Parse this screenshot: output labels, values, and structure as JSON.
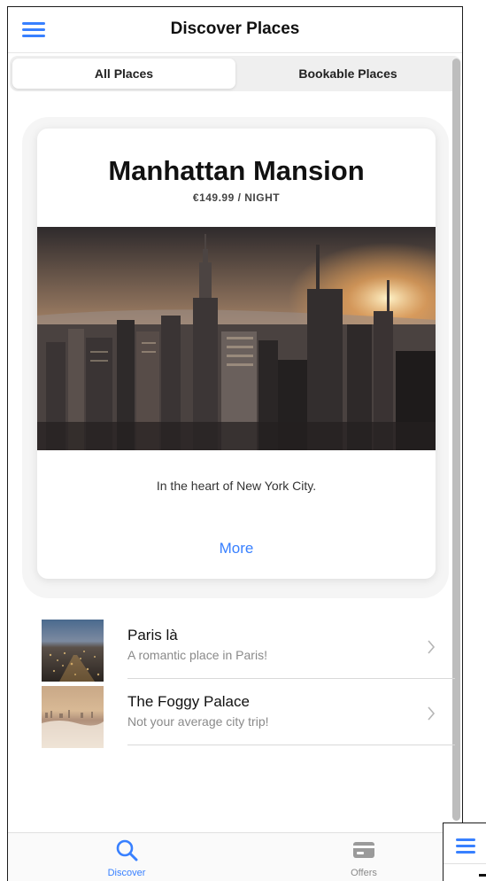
{
  "header": {
    "title": "Discover Places"
  },
  "segments": [
    {
      "label": "All Places",
      "active": true
    },
    {
      "label": "Bookable Places",
      "active": false
    }
  ],
  "featured": {
    "title": "Manhattan Mansion",
    "price": "€149.99 / NIGHT",
    "description": "In the heart of New York City.",
    "more_label": "More",
    "image_icon": "city-skyline-photo"
  },
  "places": [
    {
      "title": "Paris là",
      "subtitle": "A romantic place in Paris!",
      "thumb_icon": "paris-night-photo"
    },
    {
      "title": "The Foggy Palace",
      "subtitle": "Not your average city trip!",
      "thumb_icon": "foggy-city-photo"
    }
  ],
  "tabs": [
    {
      "label": "Discover",
      "icon": "search-icon",
      "active": true
    },
    {
      "label": "Offers",
      "icon": "card-icon",
      "active": false
    }
  ],
  "colors": {
    "accent": "#3880ff",
    "muted": "#8a8a8a"
  }
}
